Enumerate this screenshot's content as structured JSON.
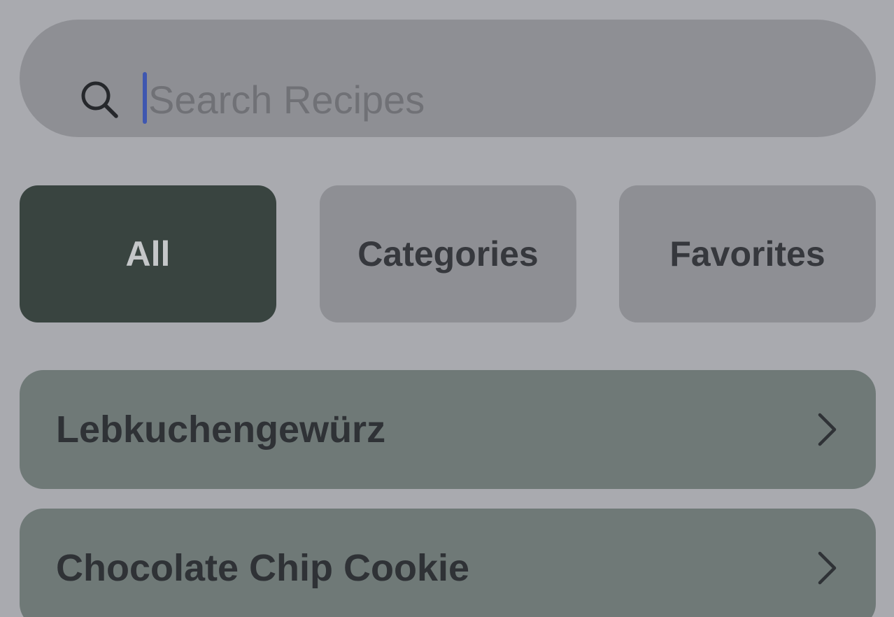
{
  "search": {
    "placeholder": "Search Recipes",
    "value": "",
    "icon": "search-icon"
  },
  "segments": {
    "items": [
      {
        "label": "All",
        "selected": true
      },
      {
        "label": "Categories",
        "selected": false
      },
      {
        "label": "Favorites",
        "selected": false
      }
    ]
  },
  "recipes": {
    "items": [
      {
        "title": "Lebkuchengewürz",
        "icon": "chevron-right-icon"
      },
      {
        "title": "Chocolate Chip Cookie",
        "icon": "chevron-right-icon"
      }
    ]
  },
  "colors": {
    "background": "#a9aaaf",
    "search_field": "#8e8f94",
    "segment_active": "#394440",
    "segment_inactive": "#8e8f94",
    "row_background": "#6f7977",
    "caret": "#3f57b0"
  }
}
